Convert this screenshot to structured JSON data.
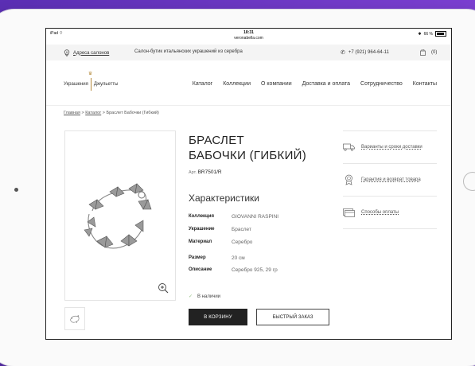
{
  "status": {
    "device": "iPad",
    "time": "18:31",
    "url": "veronabella.com",
    "battery": "66 %"
  },
  "topbar": {
    "salons": "Адреса салонов",
    "tagline": "Салон-бутик итальянских украшений из серебра",
    "phone": "+7 (921) 964-64-11",
    "cart_count": "(0)"
  },
  "logo": {
    "left": "Украшения",
    "right": "Джульетты"
  },
  "nav": [
    "Каталог",
    "Коллекции",
    "О компании",
    "Доставка и оплата",
    "Сотрудничество",
    "Контакты"
  ],
  "breadcrumb": {
    "home": "Главная",
    "sep1": " > ",
    "catalog": "Каталог",
    "sep2": " > ",
    "current": "Браслет Бабочки (Гибкий)"
  },
  "product": {
    "title_line1": "БРАСЛЕТ",
    "title_line2": "БАБОЧКИ (ГИБКИЙ)",
    "article_label": "Арт.",
    "article": "BR7501/R",
    "specs_heading": "Характеристики",
    "specs": [
      {
        "k": "Коллекция",
        "v": "GIOVANNI RASPINI"
      },
      {
        "k": "Украшение",
        "v": "Браслет"
      },
      {
        "k": "Материал",
        "v": "Серебро"
      },
      {
        "k": "Размер",
        "v": "20 см"
      },
      {
        "k": "Описание",
        "v": "Серебро 925, 29 гр"
      }
    ],
    "stock": "В наличии",
    "cart_button": "В КОРЗИНУ",
    "quick_button": "БЫСТРЫЙ ЗАКАЗ"
  },
  "side": [
    "Варианты и сроки доставки",
    "Гарантия и возврат товара",
    "Способы оплаты"
  ]
}
